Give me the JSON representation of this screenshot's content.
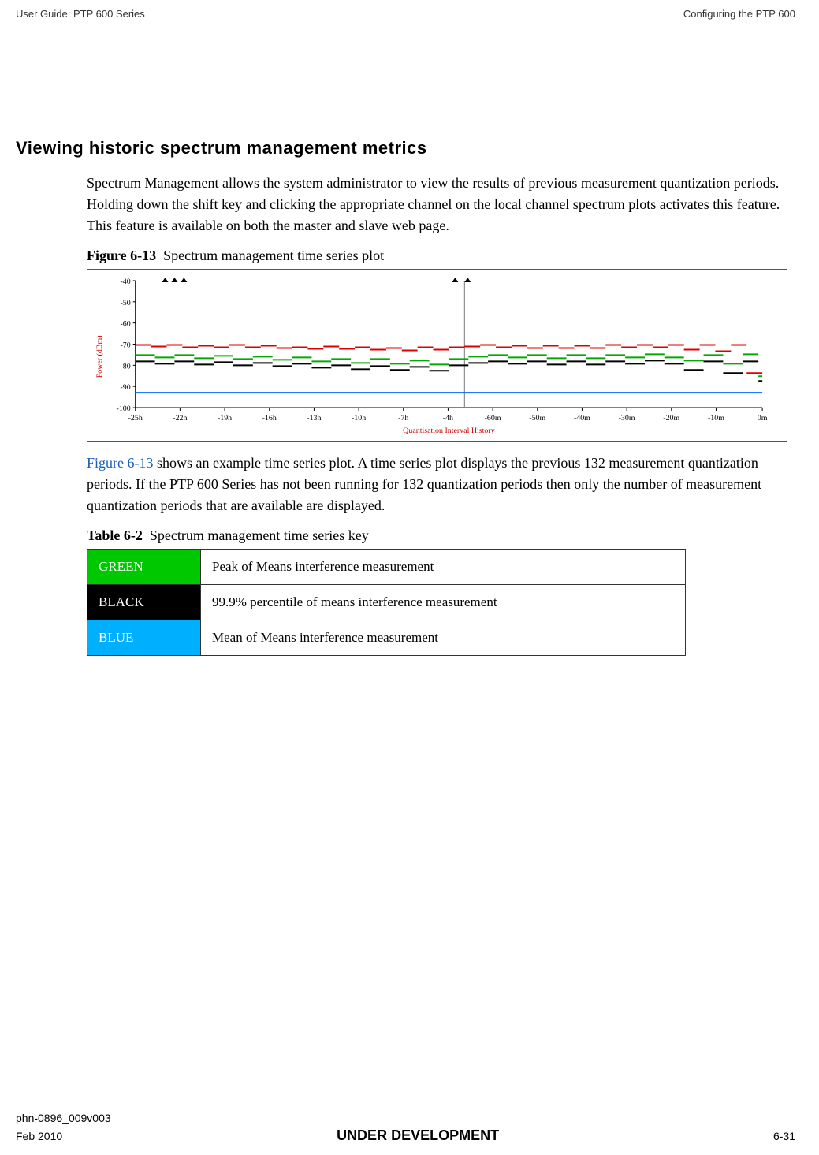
{
  "header": {
    "left": "User Guide: PTP 600 Series",
    "right": "Configuring the PTP 600"
  },
  "section": {
    "title": "Viewing historic spectrum management metrics",
    "para1": "Spectrum Management allows the system administrator to view the results of previous measurement quantization periods. Holding down the shift key and clicking the appropriate channel on the local channel spectrum plots activates this feature. This feature is available on both the master and slave web page."
  },
  "figure": {
    "label": "Figure 6-13",
    "caption": "Spectrum management time series plot",
    "ylabel": "Power (dBm)",
    "xlabel": "Quantisation Interval History"
  },
  "para2_link": "Figure 6-13",
  "para2_rest": " shows an example time series plot. A time series plot displays the previous 132 measurement quantization periods. If the PTP 600 Series has not been running for 132 quantization periods then only the number of measurement quantization periods that are available are displayed.",
  "table": {
    "label": "Table 6-2",
    "caption": "Spectrum management time series key",
    "rows": [
      {
        "color": "GREEN",
        "desc": "Peak of Means interference measurement"
      },
      {
        "color": "BLACK",
        "desc": "99.9% percentile of means interference measurement"
      },
      {
        "color": "BLUE",
        "desc": "Mean of Means interference measurement"
      }
    ]
  },
  "footer": {
    "doc_id": "phn-0896_009v003",
    "date": "Feb 2010",
    "status": "UNDER DEVELOPMENT",
    "page": "6-31"
  },
  "chart_data": {
    "type": "line",
    "title": "Spectrum management time series plot",
    "xlabel": "Quantisation Interval History",
    "ylabel": "Power (dBm)",
    "ylim": [
      -100,
      -40
    ],
    "yticks": [
      -40,
      -50,
      -60,
      -70,
      -80,
      -90,
      -100
    ],
    "xticks": [
      "-25h",
      "-22h",
      "-19h",
      "-16h",
      "-13h",
      "-10h",
      "-7h",
      "-4h",
      "-60m",
      "-50m",
      "-40m",
      "-30m",
      "-20m",
      "-10m",
      "0m"
    ],
    "series": [
      {
        "name": "Peak of Means (GREEN)",
        "approx_values_dBm": [
          -75,
          -76,
          -75,
          -75,
          -76,
          -75,
          -76,
          -77,
          -75,
          -76,
          -75,
          -76,
          -75,
          -76,
          -75,
          -75,
          -76,
          -75,
          -76,
          -76,
          -75,
          -76,
          -76,
          -76,
          -77,
          -78,
          -76,
          -77,
          -76,
          -77,
          -76,
          -77,
          -76,
          -77,
          -78,
          -77,
          -77,
          -78,
          -77,
          -78,
          -77,
          -78,
          -77,
          -78,
          -77,
          -78,
          -79,
          -78,
          -79,
          -78,
          -79,
          -79,
          -80,
          -80,
          -78,
          -79,
          -78,
          -79,
          -78,
          -79,
          -79,
          -80,
          -79,
          -80,
          -79,
          -78,
          -79,
          -78,
          -77,
          -78,
          -76,
          -77,
          -76,
          -77,
          -76,
          -77,
          -75,
          -76,
          -76,
          -77,
          -76,
          -77,
          -76,
          -77,
          -76,
          -77,
          -76,
          -77,
          -76,
          -77,
          -76,
          -77,
          -76,
          -77,
          -76,
          -75,
          -76,
          -77,
          -76,
          -75,
          -76,
          -77,
          -76,
          -77,
          -76,
          -77,
          -76,
          -77,
          -76,
          -77,
          -76,
          -75,
          -76,
          -77,
          -76,
          -77,
          -76,
          -75,
          -76,
          -75,
          -76,
          -75,
          -76,
          -75,
          -78,
          -76,
          -75,
          -76,
          -80,
          -75,
          -76,
          -85
        ]
      },
      {
        "name": "99.9% percentile (BLACK)",
        "approx_values_dBm": [
          -78,
          -79,
          -78,
          -79,
          -78,
          -79,
          -78,
          -79,
          -78,
          -79,
          -78,
          -79,
          -78,
          -79,
          -78,
          -79,
          -78,
          -79,
          -78,
          -79,
          -78,
          -79,
          -78,
          -79,
          -80,
          -81,
          -79,
          -80,
          -79,
          -80,
          -79,
          -80,
          -79,
          -80,
          -81,
          -80,
          -80,
          -81,
          -80,
          -81,
          -80,
          -81,
          -80,
          -81,
          -80,
          -81,
          -82,
          -81,
          -82,
          -81,
          -82,
          -82,
          -83,
          -83,
          -81,
          -82,
          -81,
          -82,
          -81,
          -82,
          -82,
          -83,
          -82,
          -83,
          -82,
          -81,
          -82,
          -81,
          -80,
          -81,
          -79,
          -80,
          -79,
          -80,
          -79,
          -80,
          -78,
          -79,
          -79,
          -80,
          -79,
          -80,
          -79,
          -80,
          -79,
          -80,
          -79,
          -80,
          -79,
          -80,
          -79,
          -80,
          -79,
          -80,
          -79,
          -78,
          -79,
          -80,
          -79,
          -78,
          -79,
          -80,
          -79,
          -80,
          -79,
          -80,
          -79,
          -80,
          -79,
          -80,
          -79,
          -78,
          -79,
          -80,
          -79,
          -80,
          -79,
          -78,
          -79,
          -78,
          -79,
          -78,
          -79,
          -78,
          -81,
          -80,
          -79,
          -80,
          -85,
          -78,
          -79,
          -88
        ]
      },
      {
        "name": "Mean of Means (BLUE)",
        "approx_values_dBm": [
          -93,
          -93,
          -93,
          -93,
          -93,
          -93,
          -93,
          -93,
          -93,
          -93,
          -93,
          -93,
          -93,
          -93,
          -93,
          -93,
          -93,
          -93,
          -93,
          -93,
          -93,
          -93,
          -93,
          -93,
          -93,
          -93,
          -93,
          -93,
          -93,
          -93,
          -93,
          -93,
          -93,
          -93,
          -93,
          -93,
          -93,
          -93,
          -93,
          -93,
          -93,
          -93,
          -93,
          -93,
          -93,
          -93,
          -93,
          -93,
          -93,
          -93,
          -93,
          -93,
          -93,
          -93,
          -93,
          -93,
          -93,
          -93,
          -93,
          -93,
          -93,
          -93,
          -93,
          -93,
          -93,
          -93,
          -93,
          -93,
          -93,
          -93,
          -93,
          -93,
          -93,
          -93,
          -93,
          -93,
          -93,
          -93,
          -93,
          -93,
          -93,
          -93,
          -93,
          -93,
          -93,
          -93,
          -93,
          -93,
          -93,
          -93,
          -93,
          -93,
          -93,
          -93,
          -93,
          -93,
          -93,
          -93,
          -93,
          -93,
          -93,
          -93,
          -93,
          -93,
          -93,
          -93,
          -93,
          -93,
          -93,
          -93,
          -93,
          -93,
          -93,
          -93,
          -93,
          -93,
          -93,
          -93,
          -93,
          -93,
          -93,
          -93,
          -93,
          -93,
          -93,
          -93,
          -93,
          -93,
          -93,
          -93,
          -93,
          -93
        ]
      }
    ]
  }
}
